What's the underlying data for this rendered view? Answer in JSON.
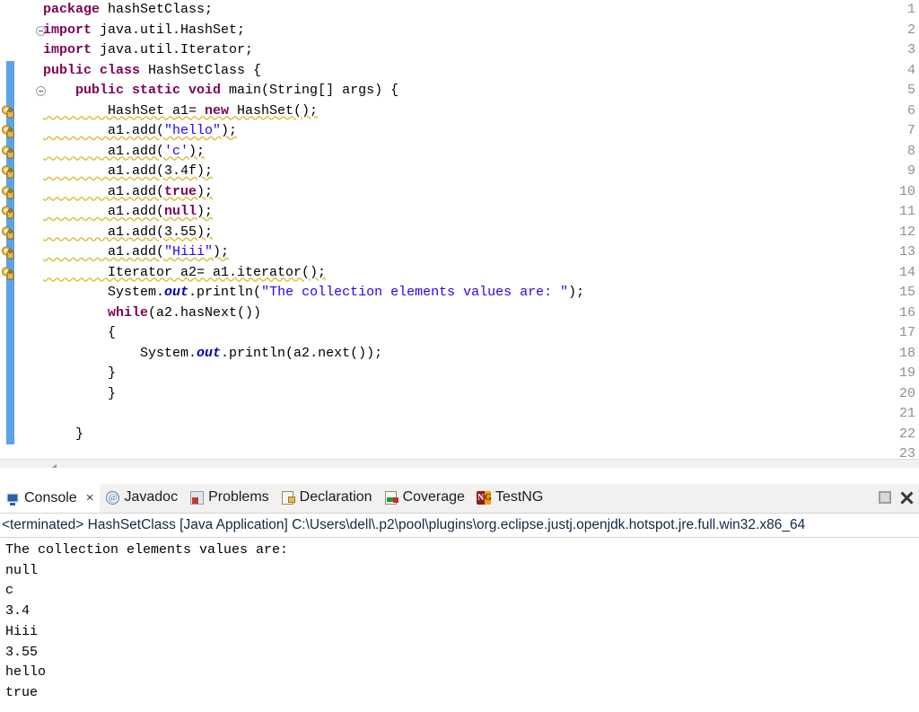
{
  "editor": {
    "name": "java-source-editor",
    "lines": [
      {
        "n": "1",
        "changed": false,
        "warn": false,
        "fold": false,
        "tokens": [
          {
            "t": "package ",
            "c": "kw"
          },
          {
            "t": "hashSetClass;",
            "c": "pl"
          }
        ],
        "indent": 0
      },
      {
        "n": "2",
        "changed": false,
        "warn": false,
        "fold": true,
        "tokens": [
          {
            "t": "import ",
            "c": "kw"
          },
          {
            "t": "java.util.HashSet;",
            "c": "pl"
          }
        ],
        "indent": 0
      },
      {
        "n": "3",
        "changed": false,
        "warn": false,
        "fold": false,
        "tokens": [
          {
            "t": "import ",
            "c": "kw"
          },
          {
            "t": "java.util.Iterator;",
            "c": "pl"
          }
        ],
        "indent": 0
      },
      {
        "n": "4",
        "changed": true,
        "warn": false,
        "fold": false,
        "tokens": [
          {
            "t": "public class ",
            "c": "kw"
          },
          {
            "t": "HashSetClass {",
            "c": "pl"
          }
        ],
        "indent": 0
      },
      {
        "n": "5",
        "changed": true,
        "warn": false,
        "fold": true,
        "tokens": [
          {
            "t": "    public static void ",
            "c": "kw"
          },
          {
            "t": "main(String[] args) {",
            "c": "pl"
          }
        ],
        "indent": 0
      },
      {
        "n": "6",
        "changed": true,
        "warn": true,
        "fold": false,
        "tokens": [
          {
            "t": "        HashSet a1= ",
            "c": "pl"
          },
          {
            "t": "new ",
            "c": "kw"
          },
          {
            "t": "HashSet();",
            "c": "pl"
          }
        ],
        "indent": 0
      },
      {
        "n": "7",
        "changed": true,
        "warn": true,
        "fold": false,
        "tokens": [
          {
            "t": "        a1.add(",
            "c": "pl"
          },
          {
            "t": "\"hello\"",
            "c": "str"
          },
          {
            "t": ");",
            "c": "pl"
          }
        ],
        "indent": 0
      },
      {
        "n": "8",
        "changed": true,
        "warn": true,
        "fold": false,
        "tokens": [
          {
            "t": "        a1.add(",
            "c": "pl"
          },
          {
            "t": "'c'",
            "c": "str"
          },
          {
            "t": ");",
            "c": "pl"
          }
        ],
        "indent": 0
      },
      {
        "n": "9",
        "changed": true,
        "warn": true,
        "fold": false,
        "tokens": [
          {
            "t": "        a1.add(3.4f);",
            "c": "pl"
          }
        ],
        "indent": 0
      },
      {
        "n": "10",
        "changed": true,
        "warn": true,
        "fold": false,
        "tokens": [
          {
            "t": "        a1.add(",
            "c": "pl"
          },
          {
            "t": "true",
            "c": "kw"
          },
          {
            "t": ");",
            "c": "pl"
          }
        ],
        "indent": 0
      },
      {
        "n": "11",
        "changed": true,
        "warn": true,
        "fold": false,
        "tokens": [
          {
            "t": "        a1.add(",
            "c": "pl"
          },
          {
            "t": "null",
            "c": "kw"
          },
          {
            "t": ");",
            "c": "pl"
          }
        ],
        "indent": 0
      },
      {
        "n": "12",
        "changed": true,
        "warn": true,
        "fold": false,
        "tokens": [
          {
            "t": "        a1.add(3.55);",
            "c": "pl"
          }
        ],
        "indent": 0
      },
      {
        "n": "13",
        "changed": true,
        "warn": true,
        "fold": false,
        "tokens": [
          {
            "t": "        a1.add(",
            "c": "pl"
          },
          {
            "t": "\"Hiii\"",
            "c": "str"
          },
          {
            "t": ");",
            "c": "pl"
          }
        ],
        "indent": 0
      },
      {
        "n": "14",
        "changed": true,
        "warn": true,
        "fold": false,
        "tokens": [
          {
            "t": "        Iterator a2= a1.iterator();",
            "c": "pl"
          }
        ],
        "indent": 0
      },
      {
        "n": "15",
        "changed": true,
        "warn": false,
        "fold": false,
        "tokens": [
          {
            "t": "        System.",
            "c": "pl"
          },
          {
            "t": "out",
            "c": "fld"
          },
          {
            "t": ".println(",
            "c": "pl"
          },
          {
            "t": "\"The collection elements values are: \"",
            "c": "str"
          },
          {
            "t": ");",
            "c": "pl"
          }
        ],
        "indent": 0
      },
      {
        "n": "16",
        "changed": true,
        "warn": false,
        "fold": false,
        "tokens": [
          {
            "t": "        ",
            "c": "pl"
          },
          {
            "t": "while",
            "c": "kw"
          },
          {
            "t": "(a2.hasNext())",
            "c": "pl"
          }
        ],
        "indent": 0
      },
      {
        "n": "17",
        "changed": true,
        "warn": false,
        "fold": false,
        "tokens": [
          {
            "t": "        {",
            "c": "pl"
          }
        ],
        "indent": 0
      },
      {
        "n": "18",
        "changed": true,
        "warn": false,
        "fold": false,
        "tokens": [
          {
            "t": "            System.",
            "c": "pl"
          },
          {
            "t": "out",
            "c": "fld"
          },
          {
            "t": ".println(a2.next());",
            "c": "pl"
          }
        ],
        "indent": 0
      },
      {
        "n": "19",
        "changed": true,
        "warn": false,
        "fold": false,
        "tokens": [
          {
            "t": "        }",
            "c": "pl"
          }
        ],
        "indent": 0
      },
      {
        "n": "20",
        "changed": true,
        "warn": false,
        "fold": false,
        "tokens": [
          {
            "t": "        }",
            "c": "pl"
          }
        ],
        "indent": 0
      },
      {
        "n": "21",
        "changed": true,
        "warn": false,
        "fold": false,
        "tokens": [
          {
            "t": "",
            "c": "pl"
          }
        ],
        "indent": 0
      },
      {
        "n": "22",
        "changed": true,
        "warn": false,
        "fold": false,
        "tokens": [
          {
            "t": "    }",
            "c": "pl"
          }
        ],
        "indent": 0
      },
      {
        "n": "23",
        "changed": false,
        "warn": false,
        "fold": false,
        "tokens": [
          {
            "t": "",
            "c": "pl"
          }
        ],
        "indent": 0
      }
    ]
  },
  "console": {
    "tabs": [
      {
        "label": "Console",
        "icon": "console-icon",
        "active": true,
        "closable": true
      },
      {
        "label": "Javadoc",
        "icon": "javadoc-icon",
        "active": false,
        "closable": false
      },
      {
        "label": "Problems",
        "icon": "problems-icon",
        "active": false,
        "closable": false
      },
      {
        "label": "Declaration",
        "icon": "declaration-icon",
        "active": false,
        "closable": false
      },
      {
        "label": "Coverage",
        "icon": "coverage-icon",
        "active": false,
        "closable": false
      },
      {
        "label": "TestNG",
        "icon": "testng-icon",
        "active": false,
        "closable": false
      }
    ],
    "close_label": "×",
    "terminated_line": "<terminated> HashSetClass [Java Application] C:\\Users\\dell\\.p2\\pool\\plugins\\org.eclipse.justj.openjdk.hotspot.jre.full.win32.x86_64",
    "output": "The collection elements values are:\nnull\nc\n3.4\nHiii\n3.55\nhello\ntrue",
    "output_lines": [
      "The collection elements values are:",
      "null",
      "c",
      "3.4",
      "Hiii",
      "3.55",
      "hello",
      "true"
    ]
  },
  "colors": {
    "keyword": "#7f0055",
    "string": "#2a00ff",
    "static_field": "#0000c0",
    "line_number": "#8f8f8f",
    "diff_marker": "#5aa3e8",
    "warning": "#e0c040",
    "tab_bar_bg": "#f2f1f0"
  }
}
